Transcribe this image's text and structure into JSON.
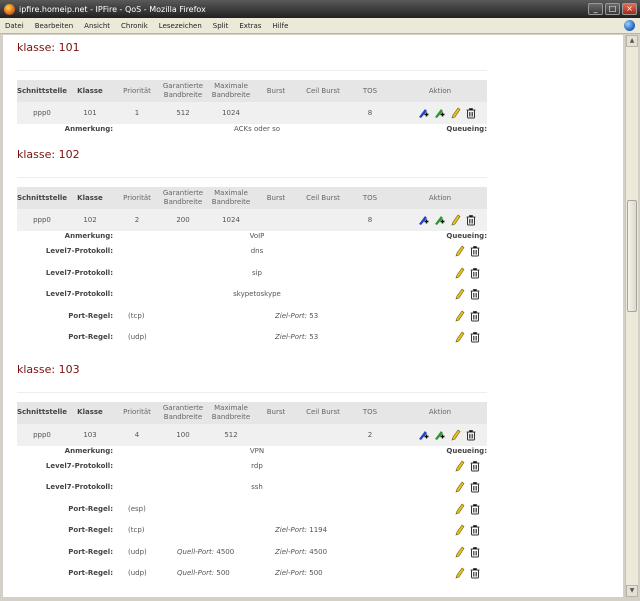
{
  "window": {
    "title": "ipfire.homeip.net - IPFire - QoS - Mozilla Firefox"
  },
  "menu": [
    "Datei",
    "Bearbeiten",
    "Ansicht",
    "Chronik",
    "Lesezeichen",
    "Split",
    "Extras",
    "Hilfe"
  ],
  "headers": {
    "schnittstelle": "Schnittstelle",
    "klasse": "Klasse",
    "prioritaet": "Priorität",
    "garantierte": "Garantierte Bandbreite",
    "maximale": "Maximale Bandbreite",
    "burst": "Burst",
    "ceil_burst": "Ceil Burst",
    "tos": "TOS",
    "aktion": "Aktion"
  },
  "labels": {
    "anmerkung": "Anmerkung:",
    "queueing": "Queueing:",
    "l7": "Level7-Protokoll:",
    "port_regel": "Port-Regel:",
    "ziel_port": "Ziel-Port:",
    "quell_port": "Quell-Port:"
  },
  "classes": [
    {
      "title": "klasse: 101",
      "row": {
        "interface": "ppp0",
        "klasse": "101",
        "prio": "1",
        "garantiert": "512",
        "maximal": "1024",
        "burst": "",
        "ceil_burst": "",
        "tos": "8"
      },
      "anmerkung": "ACKs oder so",
      "l7": [],
      "ports": []
    },
    {
      "title": "klasse: 102",
      "row": {
        "interface": "ppp0",
        "klasse": "102",
        "prio": "2",
        "garantiert": "200",
        "maximal": "1024",
        "burst": "",
        "ceil_burst": "",
        "tos": "8"
      },
      "anmerkung": "VoIP",
      "l7": [
        "dns",
        "sip",
        "skypetoskype"
      ],
      "ports": [
        {
          "proto": "(tcp)",
          "quell": "",
          "ziel": "53"
        },
        {
          "proto": "(udp)",
          "quell": "",
          "ziel": "53"
        }
      ]
    },
    {
      "title": "klasse: 103",
      "row": {
        "interface": "ppp0",
        "klasse": "103",
        "prio": "4",
        "garantiert": "100",
        "maximal": "512",
        "burst": "",
        "ceil_burst": "",
        "tos": "2"
      },
      "anmerkung": "VPN",
      "l7": [
        "rdp",
        "ssh"
      ],
      "ports": [
        {
          "proto": "(esp)",
          "quell": "",
          "ziel": ""
        },
        {
          "proto": "(tcp)",
          "quell": "",
          "ziel": "1194"
        },
        {
          "proto": "(udp)",
          "quell": "4500",
          "ziel": "4500"
        },
        {
          "proto": "(udp)",
          "quell": "500",
          "ziel": "500"
        }
      ]
    }
  ],
  "colors": {
    "klasse_title": "#7a1010",
    "header_bg": "#e6e6e6",
    "row_bg": "#f0f0f0"
  }
}
